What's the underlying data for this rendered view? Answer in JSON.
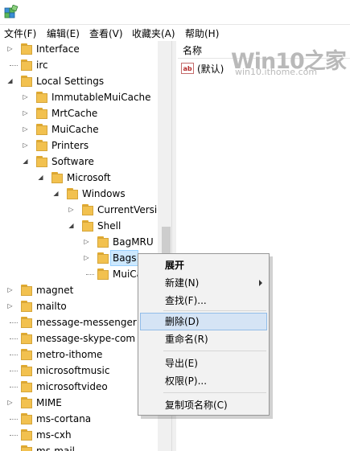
{
  "menubar": [
    {
      "label": "文件(F)",
      "name": "menu-file"
    },
    {
      "label": "编辑(E)",
      "name": "menu-edit"
    },
    {
      "label": "查看(V)",
      "name": "menu-view"
    },
    {
      "label": "收藏夹(A)",
      "name": "menu-favorites"
    },
    {
      "label": "帮助(H)",
      "name": "menu-help"
    }
  ],
  "tree": [
    {
      "label": "Interface",
      "expander": "collapsed"
    },
    {
      "label": "irc",
      "expander": "none"
    },
    {
      "label": "Local Settings",
      "expander": "expanded"
    },
    {
      "label": "ImmutableMuiCache",
      "expander": "collapsed"
    },
    {
      "label": "MrtCache",
      "expander": "collapsed"
    },
    {
      "label": "MuiCache",
      "expander": "collapsed"
    },
    {
      "label": "Printers",
      "expander": "collapsed"
    },
    {
      "label": "Software",
      "expander": "expanded"
    },
    {
      "label": "Microsoft",
      "expander": "expanded"
    },
    {
      "label": "Windows",
      "expander": "expanded"
    },
    {
      "label": "CurrentVersion",
      "expander": "collapsed"
    },
    {
      "label": "Shell",
      "expander": "expanded"
    },
    {
      "label": "BagMRU",
      "expander": "collapsed"
    },
    {
      "label": "Bags",
      "expander": "collapsed",
      "selected": true
    },
    {
      "label": "MuiCache",
      "expander": "none"
    },
    {
      "label": "magnet",
      "expander": "collapsed"
    },
    {
      "label": "mailto",
      "expander": "collapsed"
    },
    {
      "label": "message-messenger",
      "expander": "none"
    },
    {
      "label": "message-skype-com",
      "expander": "none"
    },
    {
      "label": "metro-ithome",
      "expander": "none"
    },
    {
      "label": "microsoftmusic",
      "expander": "none"
    },
    {
      "label": "microsoftvideo",
      "expander": "none"
    },
    {
      "label": "MIME",
      "expander": "collapsed"
    },
    {
      "label": "ms-cortana",
      "expander": "none"
    },
    {
      "label": "ms-cxh",
      "expander": "none"
    },
    {
      "label": "ms-mail",
      "expander": "none"
    }
  ],
  "right_pane": {
    "column_name": "名称",
    "value_icon": "ab",
    "value_name": "(默认)"
  },
  "watermark": {
    "logo": "Win10之家",
    "url": "win10.ithome.com"
  },
  "context_menu": [
    {
      "label": "展开",
      "name": "ctx-expand",
      "bold": true
    },
    {
      "label": "新建(N)",
      "name": "ctx-new",
      "submenu": true
    },
    {
      "label": "查找(F)...",
      "name": "ctx-find"
    },
    {
      "label": "删除(D)",
      "name": "ctx-delete",
      "hover": true
    },
    {
      "label": "重命名(R)",
      "name": "ctx-rename"
    },
    {
      "label": "导出(E)",
      "name": "ctx-export"
    },
    {
      "label": "权限(P)...",
      "name": "ctx-permissions"
    },
    {
      "label": "复制项名称(C)",
      "name": "ctx-copy-key-name"
    }
  ],
  "colors": {
    "folder": "#f2c14f",
    "selection": "#cce8ff",
    "menu_hover": "#d5e4f5"
  }
}
